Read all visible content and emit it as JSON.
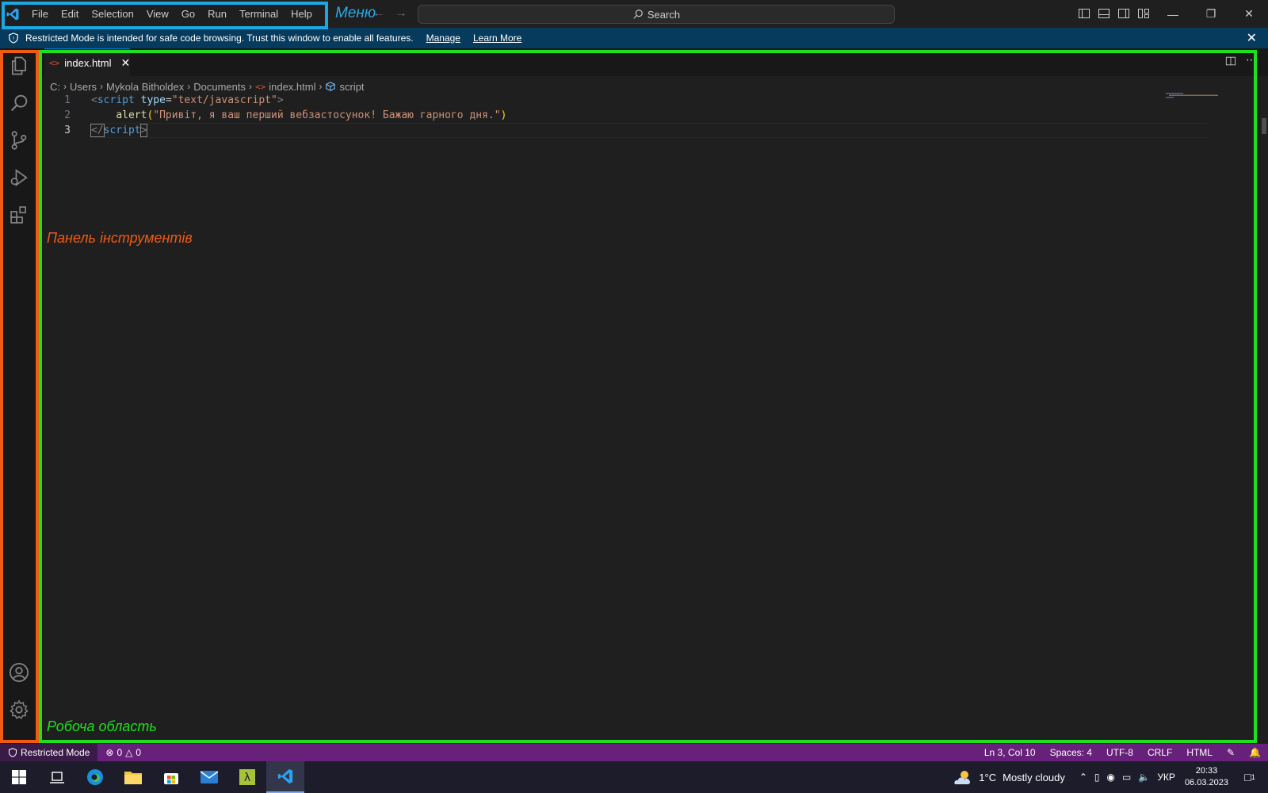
{
  "menu": {
    "items": [
      "File",
      "Edit",
      "Selection",
      "View",
      "Go",
      "Run",
      "Terminal",
      "Help"
    ]
  },
  "annotations": {
    "menu_label": "Меню",
    "tools_label": "Панель інструментів",
    "workspace_label": "Робоча область",
    "colors": {
      "menu": "#1ba7e3",
      "tools": "#f05a12",
      "workspace": "#1ee01e"
    }
  },
  "search": {
    "label": "Search"
  },
  "banner": {
    "text": "Restricted Mode is intended for safe code browsing. Trust this window to enable all features.",
    "manage": "Manage",
    "learn_more": "Learn More"
  },
  "tab": {
    "filename": "index.html"
  },
  "breadcrumb": [
    "C:",
    "Users",
    "Mykola Bitholdex",
    "Documents",
    "index.html",
    "script"
  ],
  "code": {
    "line_numbers": [
      "1",
      "2",
      "3"
    ],
    "line1": {
      "open": "<",
      "tag": "script",
      "attr": "type",
      "eq": "=",
      "value": "\"text/javascript\"",
      "close": ">"
    },
    "line2": {
      "fn": "alert",
      "paren_open": "(",
      "str": "\"Привіт, я ваш перший вебзастосунок! Бажаю гарного дня.\"",
      "paren_close": ")"
    },
    "line3": {
      "open": "</",
      "tag": "script",
      "close": ">"
    }
  },
  "status": {
    "restricted": "Restricted Mode",
    "errors": "0",
    "warnings": "0",
    "position": "Ln 3, Col 10",
    "spaces": "Spaces: 4",
    "encoding": "UTF-8",
    "eol": "CRLF",
    "language": "HTML"
  },
  "taskbar": {
    "temperature": "1°C",
    "weather": "Mostly cloudy",
    "language": "УКР",
    "time": "20:33",
    "date": "06.03.2023",
    "notifications": "1"
  },
  "colors": {
    "statusbar": "#68217a",
    "banner": "#063b5e",
    "accent": "#0078d4"
  }
}
